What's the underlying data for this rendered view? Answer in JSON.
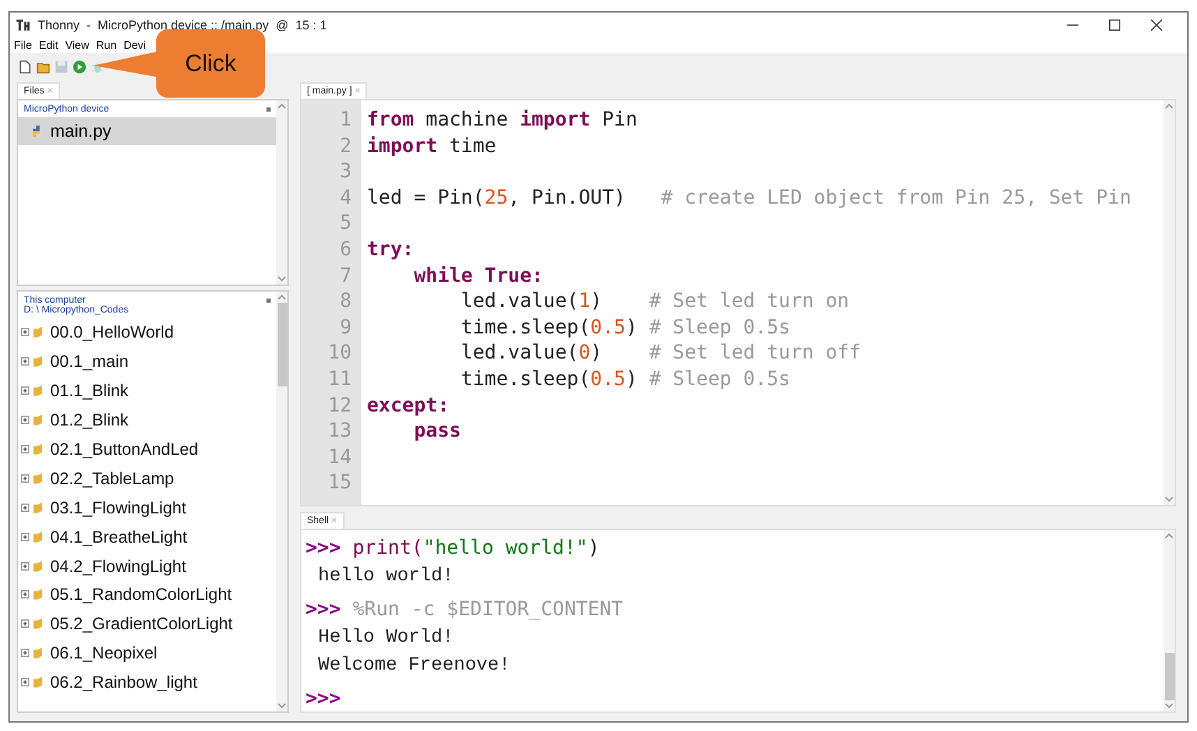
{
  "window": {
    "title": "Thonny  -  MicroPython device :: /main.py  @  15 : 1"
  },
  "menu": [
    "File",
    "Edit",
    "View",
    "Run",
    "Devi"
  ],
  "toolbar": [
    {
      "kind": "new",
      "disabled": false
    },
    {
      "kind": "open",
      "disabled": false
    },
    {
      "kind": "save",
      "disabled": true
    },
    {
      "kind": "run",
      "disabled": false
    },
    {
      "kind": "debug",
      "disabled": true
    }
  ],
  "callout": {
    "text": "Click"
  },
  "files_tab": {
    "label": "Files",
    "close": "×"
  },
  "device_pane": {
    "header": "MicroPython device",
    "items": [
      {
        "name": "main.py",
        "selected": true
      }
    ]
  },
  "computer_pane": {
    "header": "This computer",
    "path": "D: \\ Micropython_Codes",
    "items": [
      {
        "name": "00.0_HelloWorld"
      },
      {
        "name": "00.1_main"
      },
      {
        "name": "01.1_Blink"
      },
      {
        "name": "01.2_Blink"
      },
      {
        "name": "02.1_ButtonAndLed"
      },
      {
        "name": "02.2_TableLamp"
      },
      {
        "name": "03.1_FlowingLight"
      },
      {
        "name": "04.1_BreatheLight"
      },
      {
        "name": "04.2_FlowingLight"
      },
      {
        "name": "05.1_RandomColorLight"
      },
      {
        "name": "05.2_GradientColorLight"
      },
      {
        "name": "06.1_Neopixel"
      },
      {
        "name": "06.2_Rainbow_light"
      }
    ]
  },
  "editor": {
    "tab": {
      "label": "[ main.py ]",
      "close": "×"
    },
    "lines": [
      {
        "number": "1",
        "tokens": [
          {
            "text": "from",
            "kind": "kw"
          },
          {
            "text": " machine ",
            "kind": "plain"
          },
          {
            "text": "import",
            "kind": "kw"
          },
          {
            "text": " Pin",
            "kind": "plain"
          }
        ]
      },
      {
        "number": "2",
        "tokens": [
          {
            "text": "import",
            "kind": "kw"
          },
          {
            "text": " time",
            "kind": "plain"
          }
        ]
      },
      {
        "number": "3"
      },
      {
        "number": "4",
        "tokens": [
          {
            "text": "led = Pin(",
            "kind": "plain"
          },
          {
            "text": "25",
            "kind": "num"
          },
          {
            "text": ", Pin.OUT)   ",
            "kind": "plain"
          },
          {
            "text": "# create LED object from Pin 25, Set Pin",
            "kind": "com"
          }
        ]
      },
      {
        "number": "5"
      },
      {
        "number": "6",
        "tokens": [
          {
            "text": "try:",
            "kind": "kw"
          }
        ]
      },
      {
        "number": "7",
        "tokens": [
          {
            "text": "    while",
            "kind": "kw"
          },
          {
            "text": " True:",
            "kind": "kw"
          }
        ]
      },
      {
        "number": "8",
        "tokens": [
          {
            "text": "        led.value(",
            "kind": "plain"
          },
          {
            "text": "1",
            "kind": "num"
          },
          {
            "text": ")    ",
            "kind": "plain"
          },
          {
            "text": "# Set led turn on",
            "kind": "com"
          }
        ]
      },
      {
        "number": "9",
        "tokens": [
          {
            "text": "        time.sleep(",
            "kind": "plain"
          },
          {
            "text": "0.5",
            "kind": "num"
          },
          {
            "text": ") ",
            "kind": "plain"
          },
          {
            "text": "# Sleep 0.5s",
            "kind": "com"
          }
        ]
      },
      {
        "number": "10",
        "tokens": [
          {
            "text": "        led.value(",
            "kind": "plain"
          },
          {
            "text": "0",
            "kind": "num"
          },
          {
            "text": ")    ",
            "kind": "plain"
          },
          {
            "text": "# Set led turn off",
            "kind": "com"
          }
        ]
      },
      {
        "number": "11",
        "tokens": [
          {
            "text": "        time.sleep(",
            "kind": "plain"
          },
          {
            "text": "0.5",
            "kind": "num"
          },
          {
            "text": ") ",
            "kind": "plain"
          },
          {
            "text": "# Sleep 0.5s",
            "kind": "com"
          }
        ]
      },
      {
        "number": "12",
        "tokens": [
          {
            "text": "except:",
            "kind": "kw"
          }
        ]
      },
      {
        "number": "13",
        "tokens": [
          {
            "text": "    pass",
            "kind": "kw"
          }
        ]
      },
      {
        "number": "14"
      },
      {
        "number": "15"
      }
    ]
  },
  "shell": {
    "tab": {
      "label": "Shell",
      "close": "×"
    },
    "lines": [
      {
        "kind": "input",
        "prompt": ">>>",
        "tokens": [
          {
            "text": "print(",
            "kind": "call"
          },
          {
            "text": "\"hello world!\"",
            "kind": "str"
          },
          {
            "text": ")",
            "kind": "plain"
          }
        ]
      },
      {
        "kind": "output",
        "text": "hello world!"
      },
      {
        "kind": "command",
        "prompt": ">>>",
        "text": "%Run -c $EDITOR_CONTENT"
      },
      {
        "kind": "output",
        "text": "Hello World!\nWelcome Freenove!"
      },
      {
        "kind": "prompt",
        "prompt": ">>>"
      }
    ]
  }
}
